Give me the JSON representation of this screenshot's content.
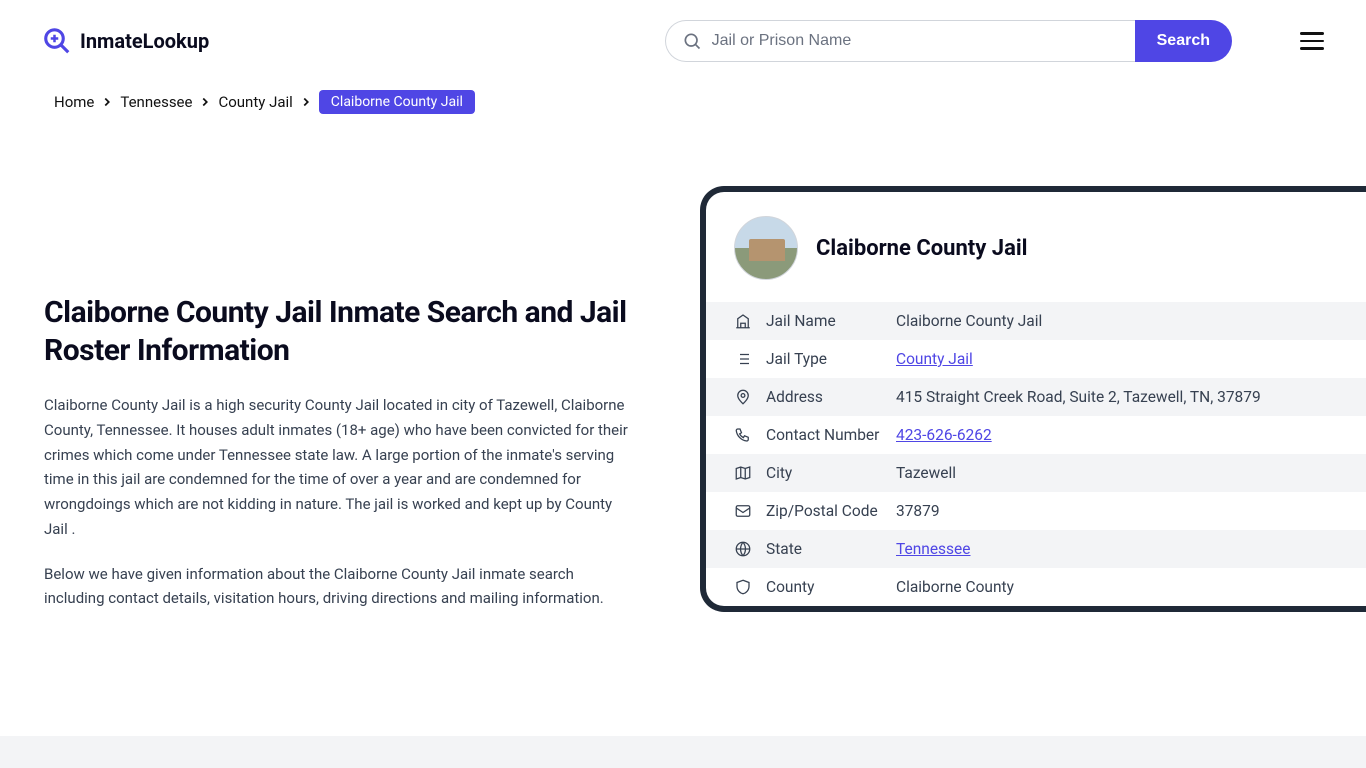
{
  "header": {
    "logo_text": "InmateLookup",
    "search_placeholder": "Jail or Prison Name",
    "search_button": "Search"
  },
  "breadcrumb": {
    "items": [
      "Home",
      "Tennessee",
      "County Jail"
    ],
    "current": "Claiborne County Jail"
  },
  "page": {
    "title": "Claiborne County Jail Inmate Search and Jail Roster Information",
    "para1": "Claiborne County Jail is a high security County Jail located in city of Tazewell, Claiborne County, Tennessee. It houses adult inmates (18+ age) who have been convicted for their crimes which come under Tennessee state law. A large portion of the inmate's serving time in this jail are condemned for the time of over a year and are condemned for wrongdoings which are not kidding in nature. The jail is worked and kept up by County Jail .",
    "para2": "Below we have given information about the Claiborne County Jail inmate search including contact details, visitation hours, driving directions and mailing information."
  },
  "card": {
    "title": "Claiborne County Jail",
    "rows": [
      {
        "label": "Jail Name",
        "value": "Claiborne County Jail",
        "link": false
      },
      {
        "label": "Jail Type",
        "value": "County Jail",
        "link": true
      },
      {
        "label": "Address",
        "value": "415 Straight Creek Road, Suite 2, Tazewell, TN, 37879",
        "link": false
      },
      {
        "label": "Contact Number",
        "value": "423-626-6262",
        "link": true
      },
      {
        "label": "City",
        "value": "Tazewell",
        "link": false
      },
      {
        "label": "Zip/Postal Code",
        "value": "37879",
        "link": false
      },
      {
        "label": "State",
        "value": "Tennessee",
        "link": true
      },
      {
        "label": "County",
        "value": "Claiborne County",
        "link": false
      }
    ]
  }
}
